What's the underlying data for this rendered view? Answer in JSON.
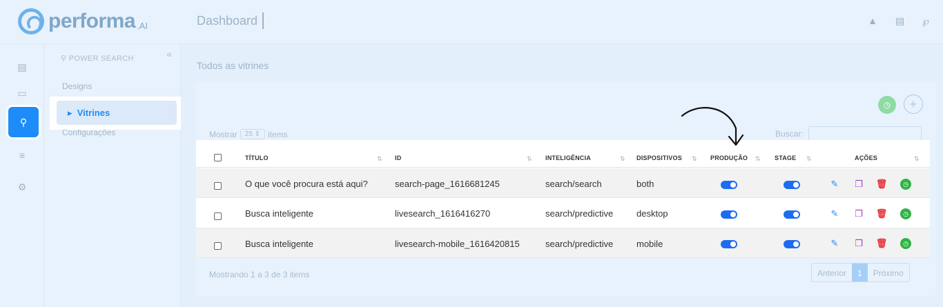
{
  "brand": {
    "name": "performa",
    "suffix": ".AI"
  },
  "header": {
    "title": "Dashboard",
    "icons": [
      "bell-icon",
      "store-icon",
      "user-icon"
    ]
  },
  "rail": {
    "items": [
      "store-icon",
      "monitor-icon",
      "search-icon",
      "sliders-icon",
      "gear-icon"
    ],
    "active_index": 2
  },
  "sidebar": {
    "search_label": "POWER SEARCH",
    "collapse_glyph": "«",
    "items": [
      {
        "label": "Designs"
      },
      {
        "label": "Vitrines",
        "active": true
      },
      {
        "label": "Configurações"
      }
    ]
  },
  "main": {
    "section_title": "Todos as vitrines",
    "show_label": "Mostrar",
    "show_value": "25",
    "items_label": "items",
    "search_label": "Buscar:",
    "search_value": "",
    "add_glyph": "+",
    "columns": [
      "TÍTULO",
      "ID",
      "INTELIGÊNCIA",
      "DISPOSITIVOS",
      "PRODUÇÃO",
      "STAGE",
      "AÇÕES"
    ],
    "rows": [
      {
        "title": "O que você procura está aqui?",
        "id": "search-page_1616681245",
        "intel": "search/search",
        "devices": "both",
        "producao": true,
        "stage": true
      },
      {
        "title": "Busca inteligente",
        "id": "livesearch_1616416270",
        "intel": "search/predictive",
        "devices": "desktop",
        "producao": true,
        "stage": true
      },
      {
        "title": "Busca inteligente",
        "id": "livesearch-mobile_1616420815",
        "intel": "search/predictive",
        "devices": "mobile",
        "producao": true,
        "stage": true
      }
    ],
    "footer_text": "Mostrando 1 a 3 de 3 items",
    "pagination": {
      "prev": "Anterior",
      "current": "1",
      "next": "Próximo"
    }
  },
  "colors": {
    "primary": "#1d8cf8",
    "edit": "#1d8cf8",
    "copy": "#9b3fc6",
    "delete": "#e8353d",
    "history": "#2fb344"
  }
}
